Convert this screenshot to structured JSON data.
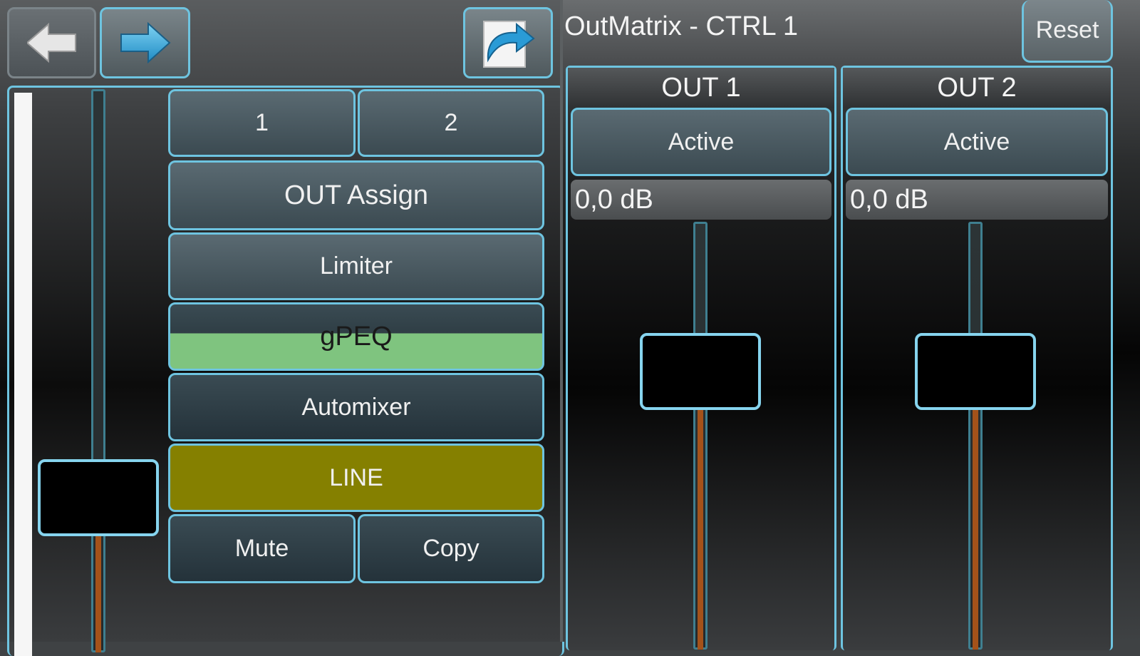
{
  "header": {
    "title": "OutMatrix - CTRL 1",
    "reset_label": "Reset"
  },
  "nav": {
    "back_icon": "back-arrow-icon",
    "forward_icon": "forward-arrow-icon",
    "page_icon": "page-curl-arrow-icon"
  },
  "input_fader": {
    "level": 0.25
  },
  "controls": {
    "tab_1": "1",
    "tab_2": "2",
    "out_assign": "OUT Assign",
    "limiter": "Limiter",
    "gpeq": "gPEQ",
    "automixer": "Automixer",
    "line": "LINE",
    "mute": "Mute",
    "copy": "Copy"
  },
  "channels": [
    {
      "name": "OUT 1",
      "active_label": "Active",
      "gain": "0,0 dB",
      "level": 0.75
    },
    {
      "name": "OUT 2",
      "active_label": "Active",
      "gain": "0,0 dB",
      "level": 0.75
    }
  ],
  "colors": {
    "accent": "#6ec4e0",
    "fader_fill": "#a4521a",
    "line_button": "#858000",
    "gpeq_indicator": "#7fc47f"
  }
}
